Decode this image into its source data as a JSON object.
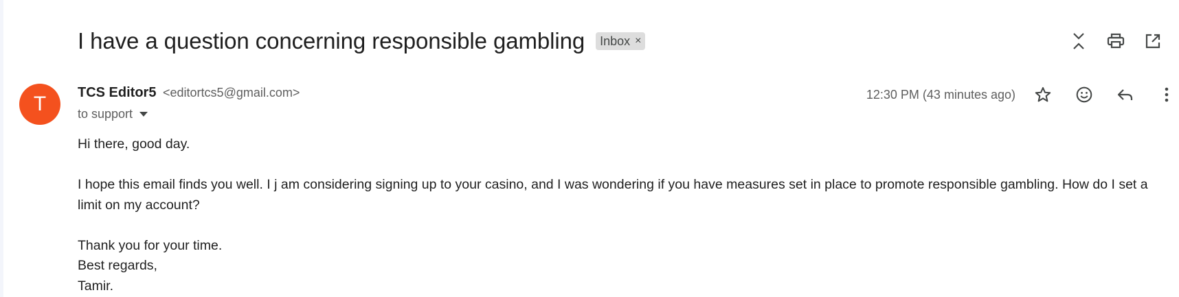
{
  "subject": "I have a question concerning responsible gambling",
  "label": {
    "name": "Inbox",
    "close": "×"
  },
  "subject_actions": [
    "collapse-all-icon",
    "print-icon",
    "open-in-new-window-icon"
  ],
  "sender": {
    "initial": "T",
    "avatar_color": "#f4511e",
    "name": "TCS Editor5",
    "email": "<editortcs5@gmail.com>",
    "to": "to support"
  },
  "timestamp": "12:30 PM (43 minutes ago)",
  "message_actions": [
    "star-icon",
    "emoji-icon",
    "reply-icon",
    "more-vert-icon"
  ],
  "body": {
    "greeting": "Hi there, good day.",
    "paragraph": "I hope this email finds you well. I j am considering signing up to your casino, and I was wondering if you have measures set in place to promote responsible gambling. How do I set a limit on my account?",
    "thanks": "Thank you for your time.",
    "closing": "Best regards,",
    "signature": "Tamir."
  }
}
